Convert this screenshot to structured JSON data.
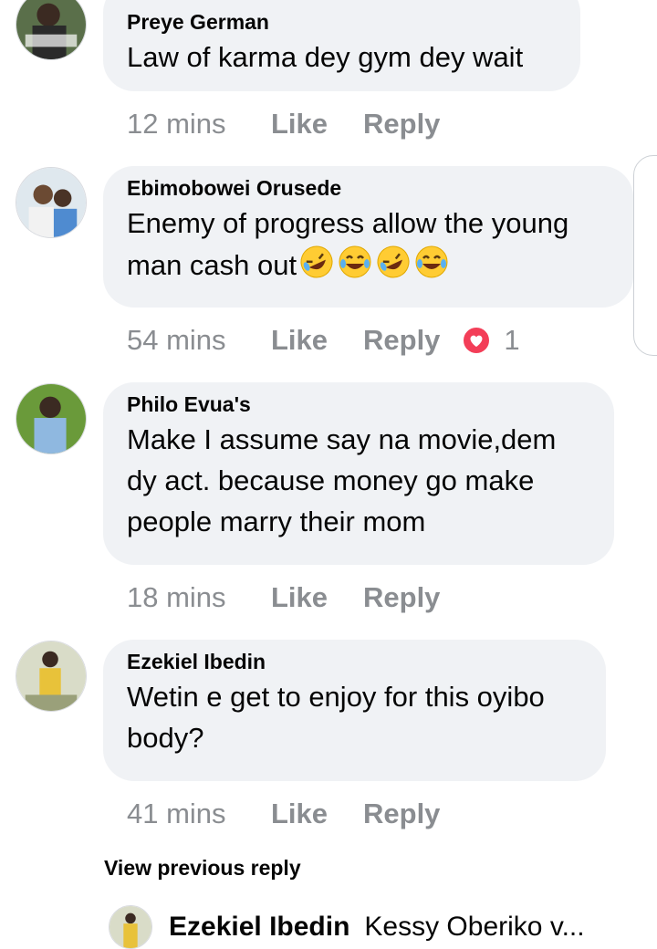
{
  "comments": [
    {
      "author": "Preye German",
      "text_lines": [
        "Law of karma dey gym dey wait"
      ],
      "time": "12 mins",
      "like_label": "Like",
      "reply_label": "Reply"
    },
    {
      "author": "Ebimobowei Orusede",
      "text_lines": [
        "Enemy of progress allow the young",
        "man cash out"
      ],
      "emojis": [
        "rolling-on-floor-laughing",
        "tears-of-joy",
        "rolling-on-floor-laughing",
        "tears-of-joy"
      ],
      "time": "54 mins",
      "like_label": "Like",
      "reply_label": "Reply",
      "reaction": {
        "type": "love",
        "count": "1",
        "color": "#f33e58"
      }
    },
    {
      "author": "Philo Evua's",
      "text_lines": [
        "Make I assume say na movie,dem",
        "dy act. because money go make",
        "people marry their mom"
      ],
      "time": "18 mins",
      "like_label": "Like",
      "reply_label": "Reply"
    },
    {
      "author": "Ezekiel Ibedin",
      "text_lines": [
        "Wetin e get to enjoy for this oyibo",
        "body?"
      ],
      "time": "41 mins",
      "like_label": "Like",
      "reply_label": "Reply"
    }
  ],
  "view_previous_reply": "View previous reply",
  "bottom_reply": {
    "author": "Ezekiel Ibedin",
    "text": "Kessy Oberiko v..."
  },
  "colors": {
    "bubble": "#f0f2f5",
    "meta_text": "#8a8d91",
    "text": "#050505",
    "love": "#f33e58",
    "emoji_face": "#ffcc33"
  }
}
